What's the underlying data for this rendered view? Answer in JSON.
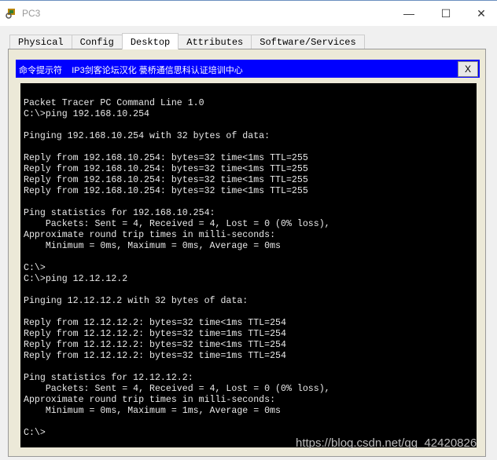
{
  "window": {
    "title": "PC3",
    "minimize": "—",
    "maximize": "☐",
    "close": "✕"
  },
  "tabs": [
    {
      "label": "Physical"
    },
    {
      "label": "Config"
    },
    {
      "label": "Desktop",
      "active": true
    },
    {
      "label": "Attributes"
    },
    {
      "label": "Software/Services"
    }
  ],
  "cmd_bar": {
    "title": "命令提示符    IP3剑客论坛汉化 甍桥通信思科认证培训中心",
    "close": "X",
    "color": "#0000ff"
  },
  "terminal": {
    "lines": [
      "Packet Tracer PC Command Line 1.0",
      "C:\\>ping 192.168.10.254",
      "",
      "Pinging 192.168.10.254 with 32 bytes of data:",
      "",
      "Reply from 192.168.10.254: bytes=32 time<1ms TTL=255",
      "Reply from 192.168.10.254: bytes=32 time<1ms TTL=255",
      "Reply from 192.168.10.254: bytes=32 time<1ms TTL=255",
      "Reply from 192.168.10.254: bytes=32 time<1ms TTL=255",
      "",
      "Ping statistics for 192.168.10.254:",
      "    Packets: Sent = 4, Received = 4, Lost = 0 (0% loss),",
      "Approximate round trip times in milli-seconds:",
      "    Minimum = 0ms, Maximum = 0ms, Average = 0ms",
      "",
      "C:\\>",
      "C:\\>ping 12.12.12.2",
      "",
      "Pinging 12.12.12.2 with 32 bytes of data:",
      "",
      "Reply from 12.12.12.2: bytes=32 time<1ms TTL=254",
      "Reply from 12.12.12.2: bytes=32 time=1ms TTL=254",
      "Reply from 12.12.12.2: bytes=32 time<1ms TTL=254",
      "Reply from 12.12.12.2: bytes=32 time=1ms TTL=254",
      "",
      "Ping statistics for 12.12.12.2:",
      "    Packets: Sent = 4, Received = 4, Lost = 0 (0% loss),",
      "Approximate round trip times in milli-seconds:",
      "    Minimum = 0ms, Maximum = 1ms, Average = 0ms",
      "",
      "C:\\>"
    ]
  },
  "watermark": "https://blog.csdn.net/qq_42420826"
}
